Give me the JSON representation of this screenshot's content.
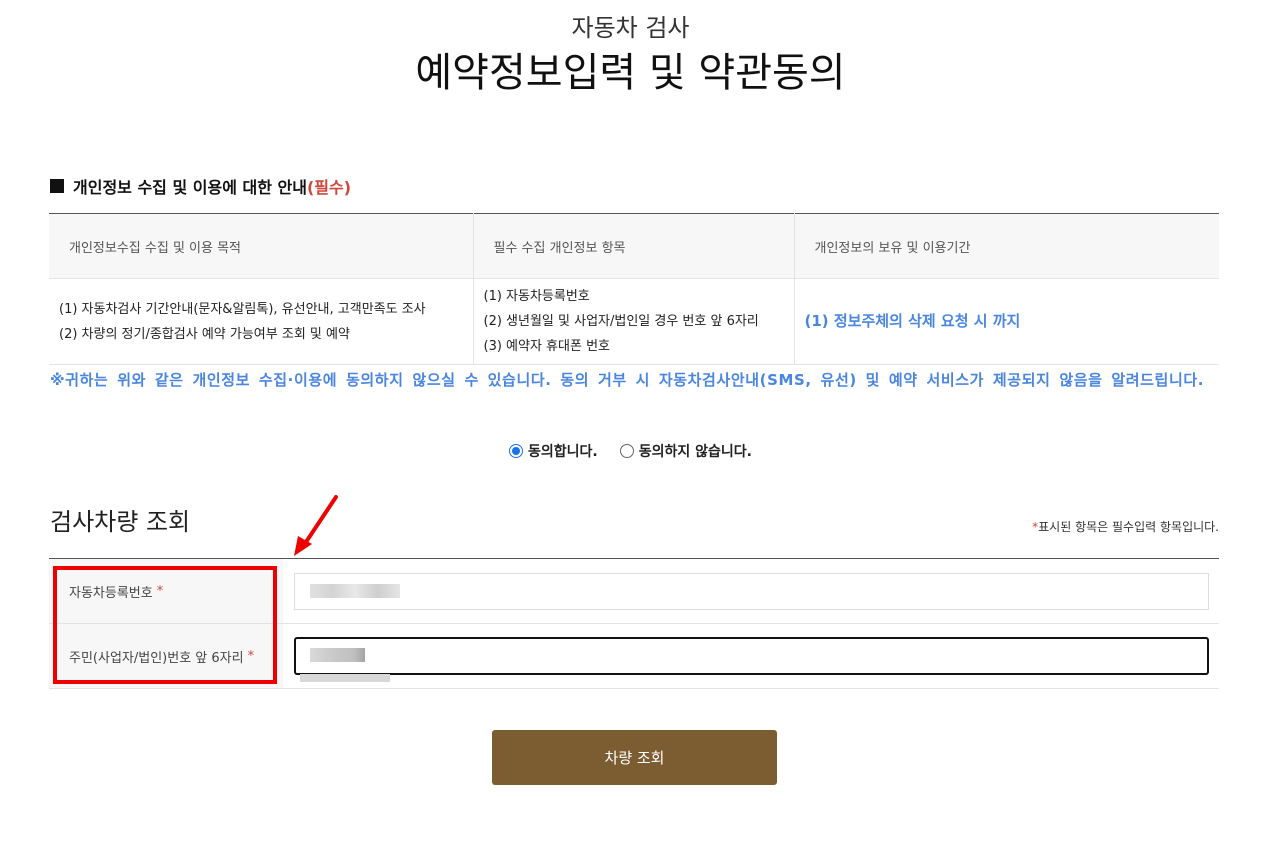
{
  "header": {
    "subtitle": "자동차 검사",
    "title": "예약정보입력 및 약관동의"
  },
  "privacy_section": {
    "title": "개인정보 수집 및 이용에 대한 안내",
    "required_tag": "(필수)",
    "columns": [
      "개인정보수집 수집 및 이용 목적",
      "필수 수집 개인정보 항목",
      "개인정보의 보유 및 이용기간"
    ],
    "purposes": [
      "(1) 자동차검사 기간안내(문자&알림톡), 유선안내, 고객만족도 조사",
      "(2) 차량의 정기/종합검사 예약 가능여부 조회 및 예약"
    ],
    "items": [
      "(1) 자동차등록번호",
      "(2) 생년월일 및 사업자/법인일 경우 번호 앞 6자리",
      "(3) 예약자 휴대폰 번호"
    ],
    "period": "(1) 정보주체의 삭제 요청 시 까지",
    "notice": "※귀하는 위와 같은 개인정보 수집·이용에 동의하지 않으실 수 있습니다. 동의 거부 시 자동차검사안내(SMS, 유선) 및 예약 서비스가 제공되지 않음을 알려드립니다."
  },
  "consent": {
    "agree_label": "동의합니다.",
    "disagree_label": "동의하지 않습니다.",
    "selected": "agree"
  },
  "vehicle_section": {
    "title": "검사차량 조회",
    "required_note_star": "*",
    "required_note": "표시된 항목은 필수입력 항목입니다.",
    "fields": [
      {
        "label": "자동차등록번호",
        "star": "*"
      },
      {
        "label": "주민(사업자/법인)번호 앞 6자리",
        "star": "*"
      }
    ]
  },
  "search_button": "차량 조회",
  "colors": {
    "accent_blue": "#4a86e0",
    "required_red": "#d2463c",
    "button_brown": "#7c5d32",
    "highlight_red": "#ee0000"
  }
}
